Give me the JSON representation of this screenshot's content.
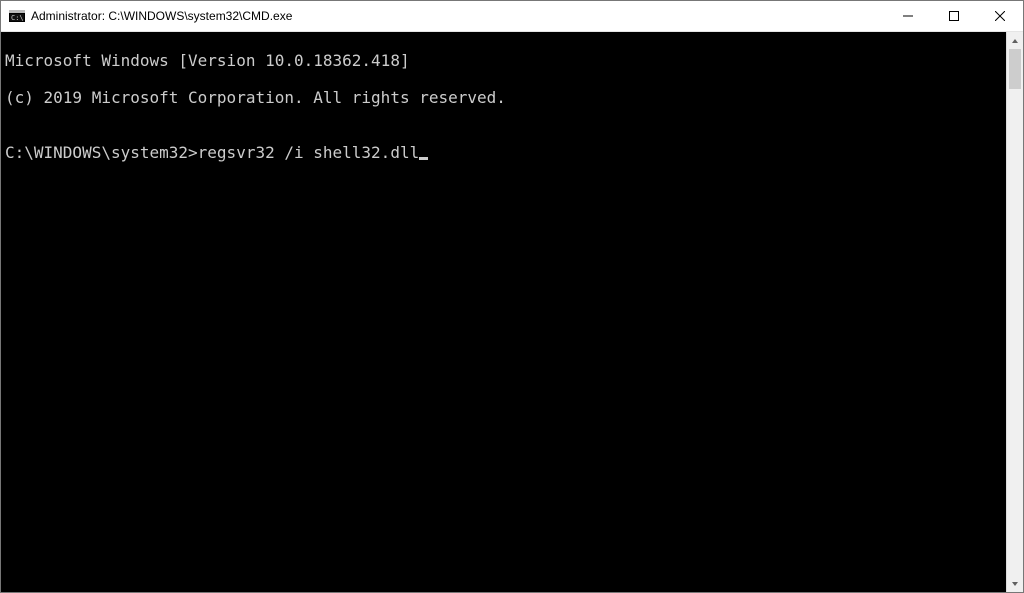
{
  "window": {
    "title": "Administrator: C:\\WINDOWS\\system32\\CMD.exe"
  },
  "console": {
    "line1": "Microsoft Windows [Version 10.0.18362.418]",
    "line2": "(c) 2019 Microsoft Corporation. All rights reserved.",
    "blank": "",
    "prompt": "C:\\WINDOWS\\system32>",
    "command": "regsvr32 /i shell32.dll"
  }
}
